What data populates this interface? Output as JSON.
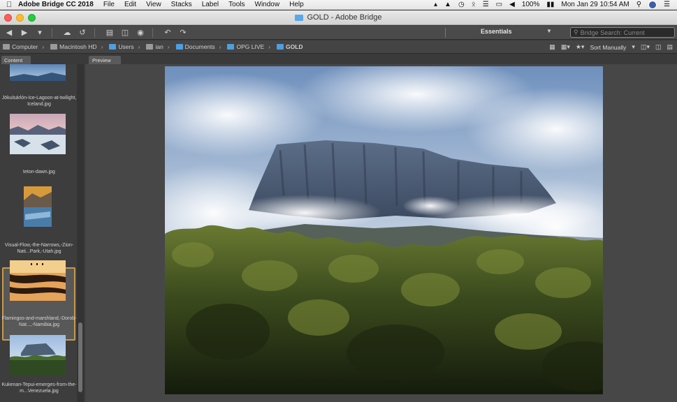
{
  "menubar": {
    "app_name": "Adobe Bridge CC 2018",
    "menus": [
      "File",
      "Edit",
      "View",
      "Stacks",
      "Label",
      "Tools",
      "Window",
      "Help"
    ],
    "battery": "100%",
    "datetime": "Mon Jan 29  10:54 AM"
  },
  "window": {
    "title": "GOLD - Adobe Bridge"
  },
  "toolbar": {
    "workspace": "Essentials",
    "search_placeholder": "Bridge Search: Current"
  },
  "pathbar": {
    "crumbs": [
      "Computer",
      "Macintosh HD",
      "Users",
      "ian",
      "Documents",
      "OPG LIVE",
      "GOLD"
    ],
    "sort_label": "Sort Manually"
  },
  "tabs": {
    "content": "Content",
    "preview": "Preview"
  },
  "content": {
    "items": [
      {
        "label": ""
      },
      {
        "label": "Jökulsárlón-Ice-Lagoon-at-twilight, Iceland.jpg"
      },
      {
        "label": "teton-dawn.jpg"
      },
      {
        "label": "Visual-Flow,-the-Narrows,-Zion-Nati...Park,-Utah.jpg"
      },
      {
        "label": "Flamingos-and-marshland,-Dorob-Nat...,-Namibia.jpg"
      },
      {
        "label": "Kukenan-Tepui-emerges-from-the-m...Venezuela.jpg"
      }
    ]
  },
  "colors": {
    "selection_border": "#c89a4a",
    "folder_blue": "#4d9fe0"
  }
}
